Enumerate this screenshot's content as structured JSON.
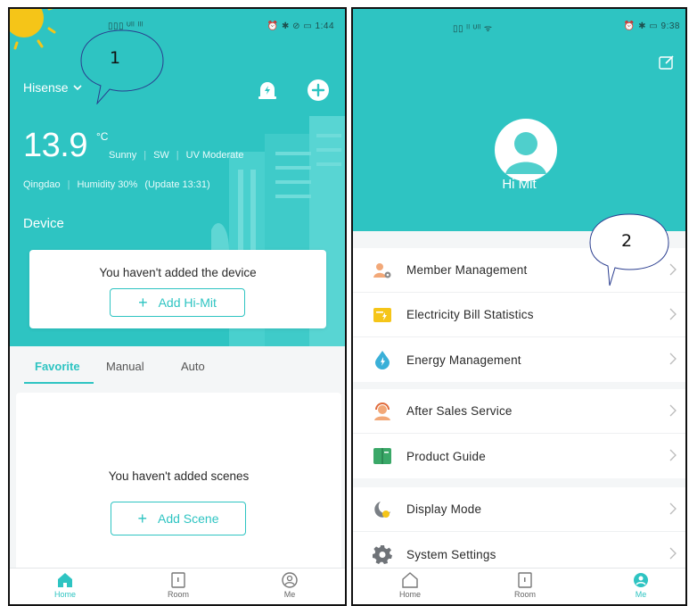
{
  "left_screen": {
    "status_bar": {
      "signal": "▯▯▯ ᵁˡˡ ˡˡˡ",
      "right": "⏰ ✱ ⊘ ▭ 1:44"
    },
    "annotation_number": "1",
    "brand": "Hisense",
    "weather": {
      "temperature": "13.9",
      "unit": "°C",
      "condition": "Sunny",
      "wind": "SW",
      "uv": "UV Moderate",
      "city": "Qingdao",
      "humidity": "Humidity 30%",
      "update": "(Update 13:31)"
    },
    "device_section": {
      "title": "Device",
      "empty_message": "You haven't added the device",
      "add_button": "Add Hi-Mit"
    },
    "tabs": [
      "Favorite",
      "Manual",
      "Auto"
    ],
    "scenes": {
      "empty_message": "You haven't added scenes",
      "add_button": "Add Scene"
    },
    "tabbar": [
      {
        "label": "Home",
        "icon": "home-icon",
        "active": true
      },
      {
        "label": "Room",
        "icon": "room-icon",
        "active": false
      },
      {
        "label": "Me",
        "icon": "me-icon",
        "active": false
      }
    ]
  },
  "right_screen": {
    "status_bar": {
      "signal": "▯▯ ˡˡ ᵁˡˡ ᯤ",
      "right": "⏰ ✱ ▭ 9:38"
    },
    "annotation_number": "2",
    "greeting": "Hi Mit",
    "menu_groups": [
      [
        {
          "label": "Member Management",
          "icon": "members-icon"
        },
        {
          "label": "Electricity Bill Statistics",
          "icon": "bill-icon"
        },
        {
          "label": "Energy Management",
          "icon": "energy-drop-icon"
        }
      ],
      [
        {
          "label": "After Sales Service",
          "icon": "support-icon"
        },
        {
          "label": "Product Guide",
          "icon": "guide-book-icon"
        }
      ],
      [
        {
          "label": "Display Mode",
          "icon": "display-mode-icon"
        },
        {
          "label": "System Settings",
          "icon": "gear-icon"
        }
      ]
    ],
    "tabbar": [
      {
        "label": "Home",
        "icon": "home-icon",
        "active": false
      },
      {
        "label": "Room",
        "icon": "room-icon",
        "active": false
      },
      {
        "label": "Me",
        "icon": "me-icon",
        "active": true
      }
    ]
  },
  "colors": {
    "accent": "#2ec4c2",
    "background": "#f4f6f7"
  }
}
